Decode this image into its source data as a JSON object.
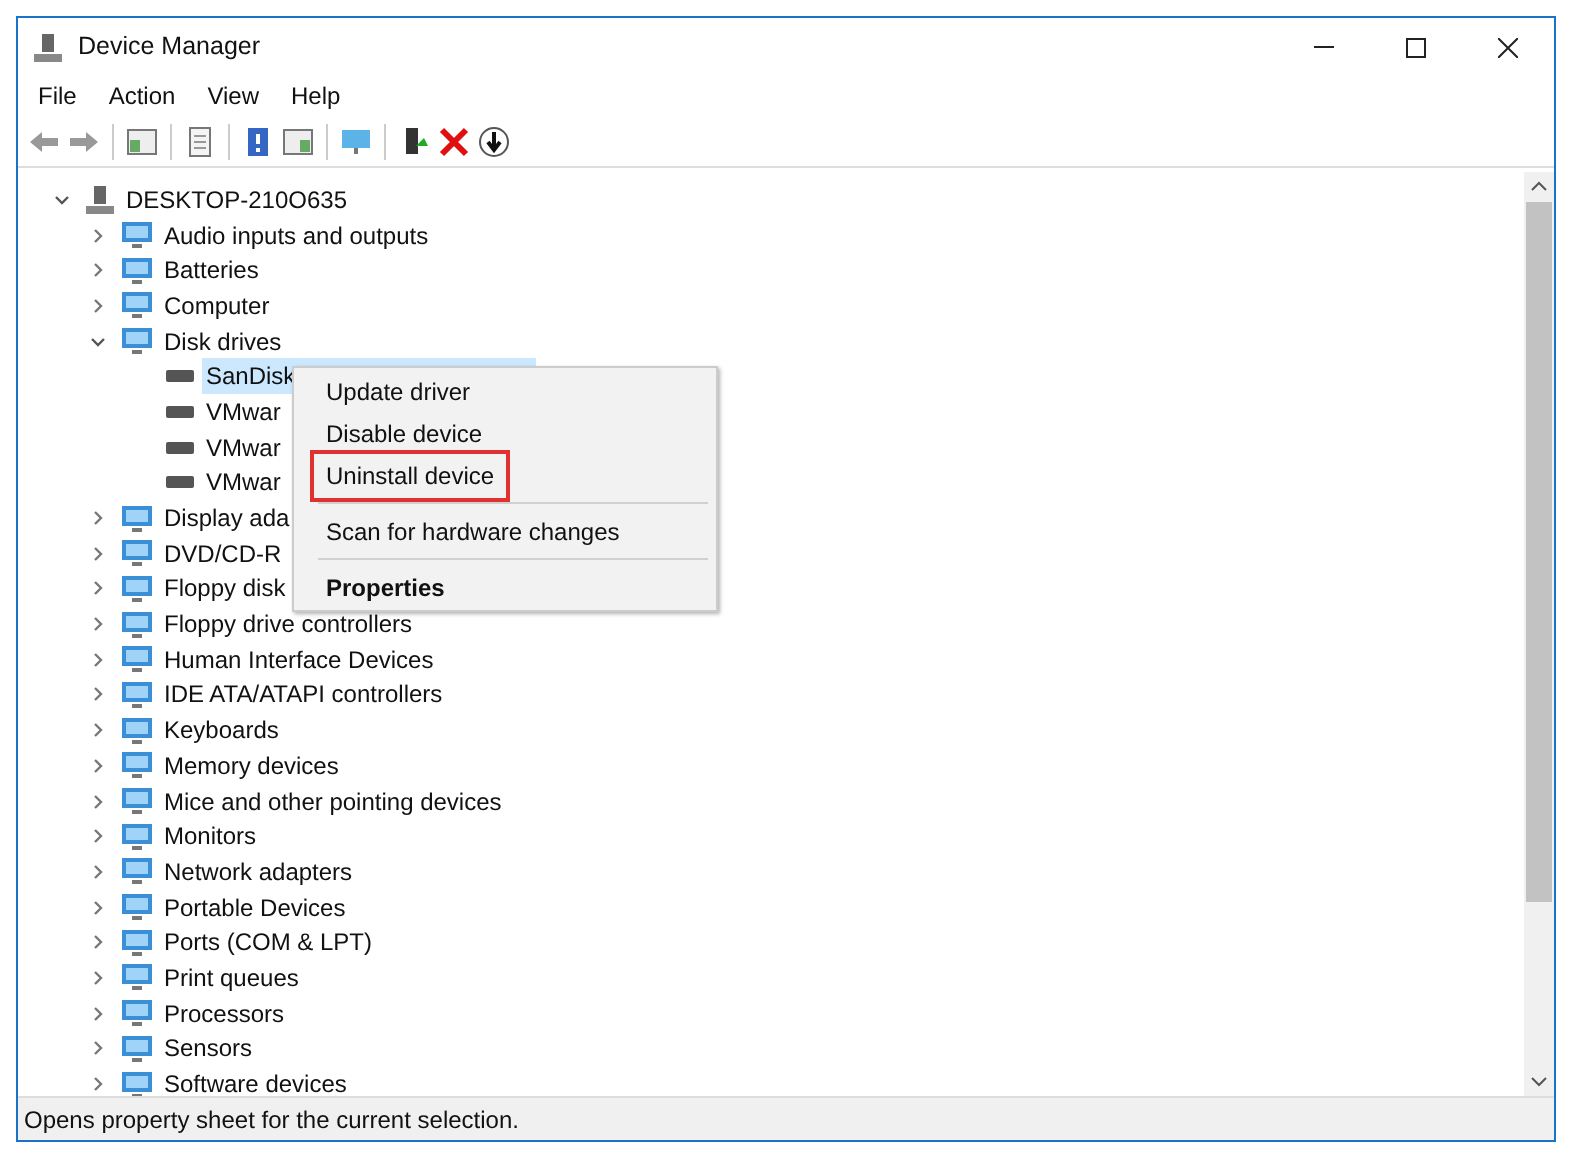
{
  "window": {
    "title": "Device Manager"
  },
  "menu_bar": [
    "File",
    "Action",
    "View",
    "Help"
  ],
  "tree": {
    "label": "DESKTOP-210O635",
    "expanded": true,
    "children": [
      {
        "label": "Audio inputs and outputs",
        "expanded": false
      },
      {
        "label": "Batteries",
        "expanded": false
      },
      {
        "label": "Computer",
        "expanded": false
      },
      {
        "label": "Disk drives",
        "expanded": true,
        "children": [
          {
            "label": "SanDisk",
            "selected": true
          },
          {
            "label": "VMwar",
            "selected": false
          },
          {
            "label": "VMwar",
            "selected": false
          },
          {
            "label": "VMwar",
            "selected": false
          }
        ]
      },
      {
        "label": "Display ada",
        "expanded": false
      },
      {
        "label": "DVD/CD-R",
        "expanded": false
      },
      {
        "label": "Floppy disk",
        "expanded": false
      },
      {
        "label": "Floppy drive controllers",
        "expanded": false
      },
      {
        "label": "Human Interface Devices",
        "expanded": false
      },
      {
        "label": "IDE ATA/ATAPI controllers",
        "expanded": false
      },
      {
        "label": "Keyboards",
        "expanded": false
      },
      {
        "label": "Memory devices",
        "expanded": false
      },
      {
        "label": "Mice and other pointing devices",
        "expanded": false
      },
      {
        "label": "Monitors",
        "expanded": false
      },
      {
        "label": "Network adapters",
        "expanded": false
      },
      {
        "label": "Portable Devices",
        "expanded": false
      },
      {
        "label": "Ports (COM & LPT)",
        "expanded": false
      },
      {
        "label": "Print queues",
        "expanded": false
      },
      {
        "label": "Processors",
        "expanded": false
      },
      {
        "label": "Sensors",
        "expanded": false
      },
      {
        "label": "Software devices",
        "expanded": false
      }
    ]
  },
  "context_menu": [
    {
      "kind": "item",
      "label": "Update driver",
      "bold": false,
      "outlined": false
    },
    {
      "kind": "item",
      "label": "Disable device",
      "bold": false,
      "outlined": false
    },
    {
      "kind": "item",
      "label": "Uninstall device",
      "bold": false,
      "outlined": true
    },
    {
      "kind": "separator"
    },
    {
      "kind": "item",
      "label": "Scan for hardware changes",
      "bold": false,
      "outlined": false
    },
    {
      "kind": "separator"
    },
    {
      "kind": "item",
      "label": "Properties",
      "bold": true,
      "outlined": false
    }
  ],
  "status_bar": "Opens property sheet for the current selection."
}
